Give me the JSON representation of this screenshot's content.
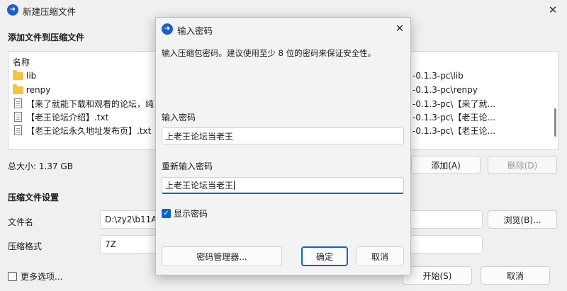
{
  "main": {
    "title": "新建压缩文件",
    "add_files_title": "添加文件到压缩文件",
    "list_header": "名称",
    "files": [
      {
        "name": "lib",
        "type": "folder",
        "path": "-0.1.3-pc\\lib"
      },
      {
        "name": "renpy",
        "type": "folder",
        "path": "-0.1.3-pc\\renpy"
      },
      {
        "name": "【来了就能下载和观看的论坛，纯",
        "type": "file",
        "path": "-0.1.3-pc\\【来了就..."
      },
      {
        "name": "【老王论坛介绍】.txt",
        "type": "file",
        "path": "-0.1.3-pc\\【老王论..."
      },
      {
        "name": "【老王论坛永久地址发布页】.txt",
        "type": "file",
        "path": "-0.1.3-pc\\【老王论..."
      }
    ],
    "total_size": "总大小: 1.37 GB",
    "add_button": "添加(A)",
    "delete_button": "删除(D)",
    "settings_title": "压缩文件设置",
    "filename_label": "文件名",
    "filename_value": "D:\\zy2\\b11A",
    "browse_button": "浏览(B)...",
    "format_label": "压缩格式",
    "format_value": "7Z",
    "more_options": "更多选项...",
    "start_button": "开始(S)",
    "cancel_button": "取消"
  },
  "dialog": {
    "title": "输入密码",
    "description": "输入压缩包密码。建议使用至少 8 位的密码来保证安全性。",
    "password_label": "输入密码",
    "password_value": "上老王论坛当老王",
    "confirm_label": "重新输入密码",
    "confirm_value": "上老王论坛当老王",
    "show_password": "显示密码",
    "manager_button": "密码管理器...",
    "ok_button": "确定",
    "cancel_button": "取消"
  },
  "colors": {
    "accent": "#0a63c8",
    "folder": "#f5c342"
  }
}
